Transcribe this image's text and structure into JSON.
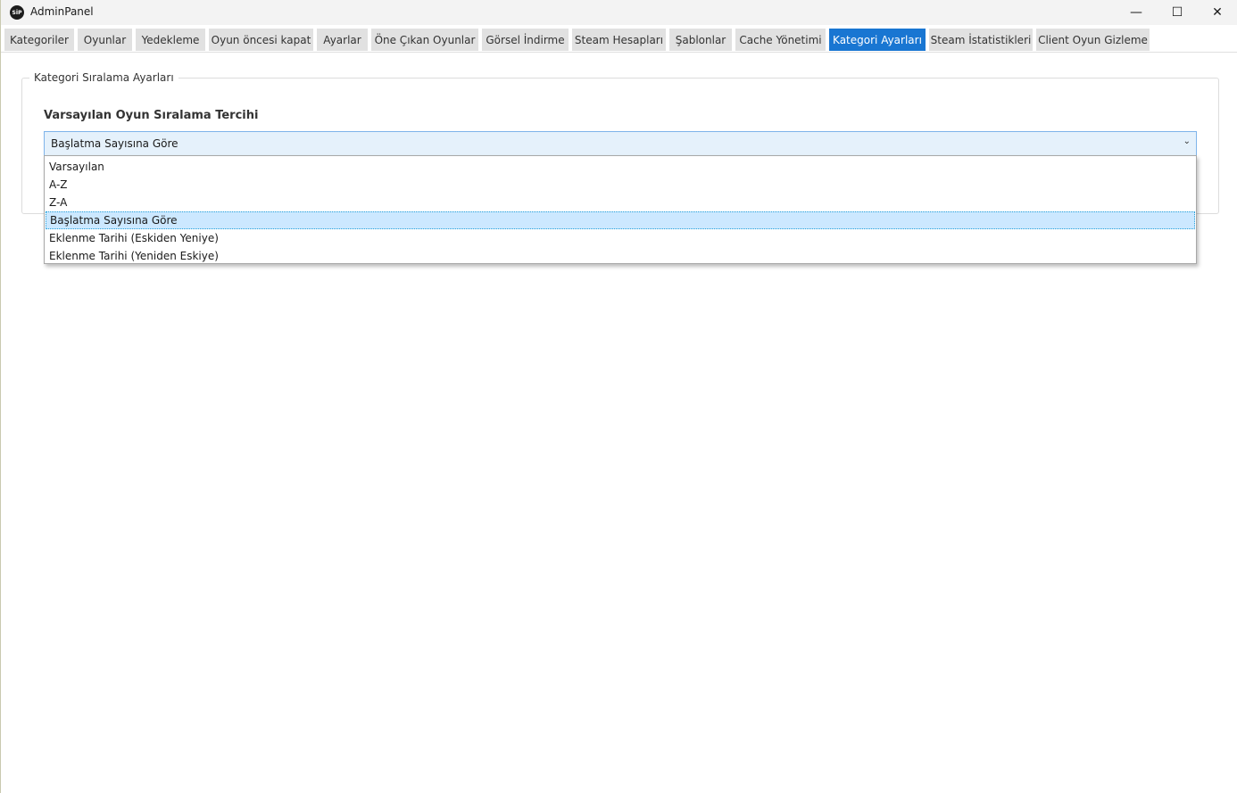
{
  "window": {
    "title": "AdminPanel",
    "icon": "app-logo-icon",
    "icon_text": "SİP"
  },
  "window_controls": {
    "minimize": "—",
    "maximize": "☐",
    "close": "✕"
  },
  "tabs": [
    {
      "label": "Kategoriler",
      "active": false
    },
    {
      "label": "Oyunlar",
      "active": false
    },
    {
      "label": "Yedekleme",
      "active": false
    },
    {
      "label": "Oyun öncesi kapat",
      "active": false
    },
    {
      "label": "Ayarlar",
      "active": false
    },
    {
      "label": "Öne Çıkan Oyunlar",
      "active": false
    },
    {
      "label": "Görsel İndirme",
      "active": false
    },
    {
      "label": "Steam Hesapları",
      "active": false
    },
    {
      "label": "Şablonlar",
      "active": false
    },
    {
      "label": "Cache Yönetimi",
      "active": false
    },
    {
      "label": "Kategori Ayarları",
      "active": true
    },
    {
      "label": "Steam İstatistikleri",
      "active": false
    },
    {
      "label": "Client Oyun Gizleme",
      "active": false
    }
  ],
  "group": {
    "title": "Kategori Sıralama Ayarları",
    "field_label": "Varsayılan Oyun Sıralama Tercihi",
    "combo_value": "Başlatma Sayısına Göre",
    "options": [
      "Varsayılan",
      "A-Z",
      "Z-A",
      "Başlatma Sayısına Göre",
      "Eklenme Tarihi (Eskiden Yeniye)",
      "Eklenme Tarihi (Yeniden Eskiye)"
    ],
    "selected_index": 3
  },
  "colors": {
    "accent": "#1976d2",
    "tab_bg": "#e1e1e1",
    "combo_bg": "#e5f1fb",
    "selected_item": "#cce8ff"
  }
}
